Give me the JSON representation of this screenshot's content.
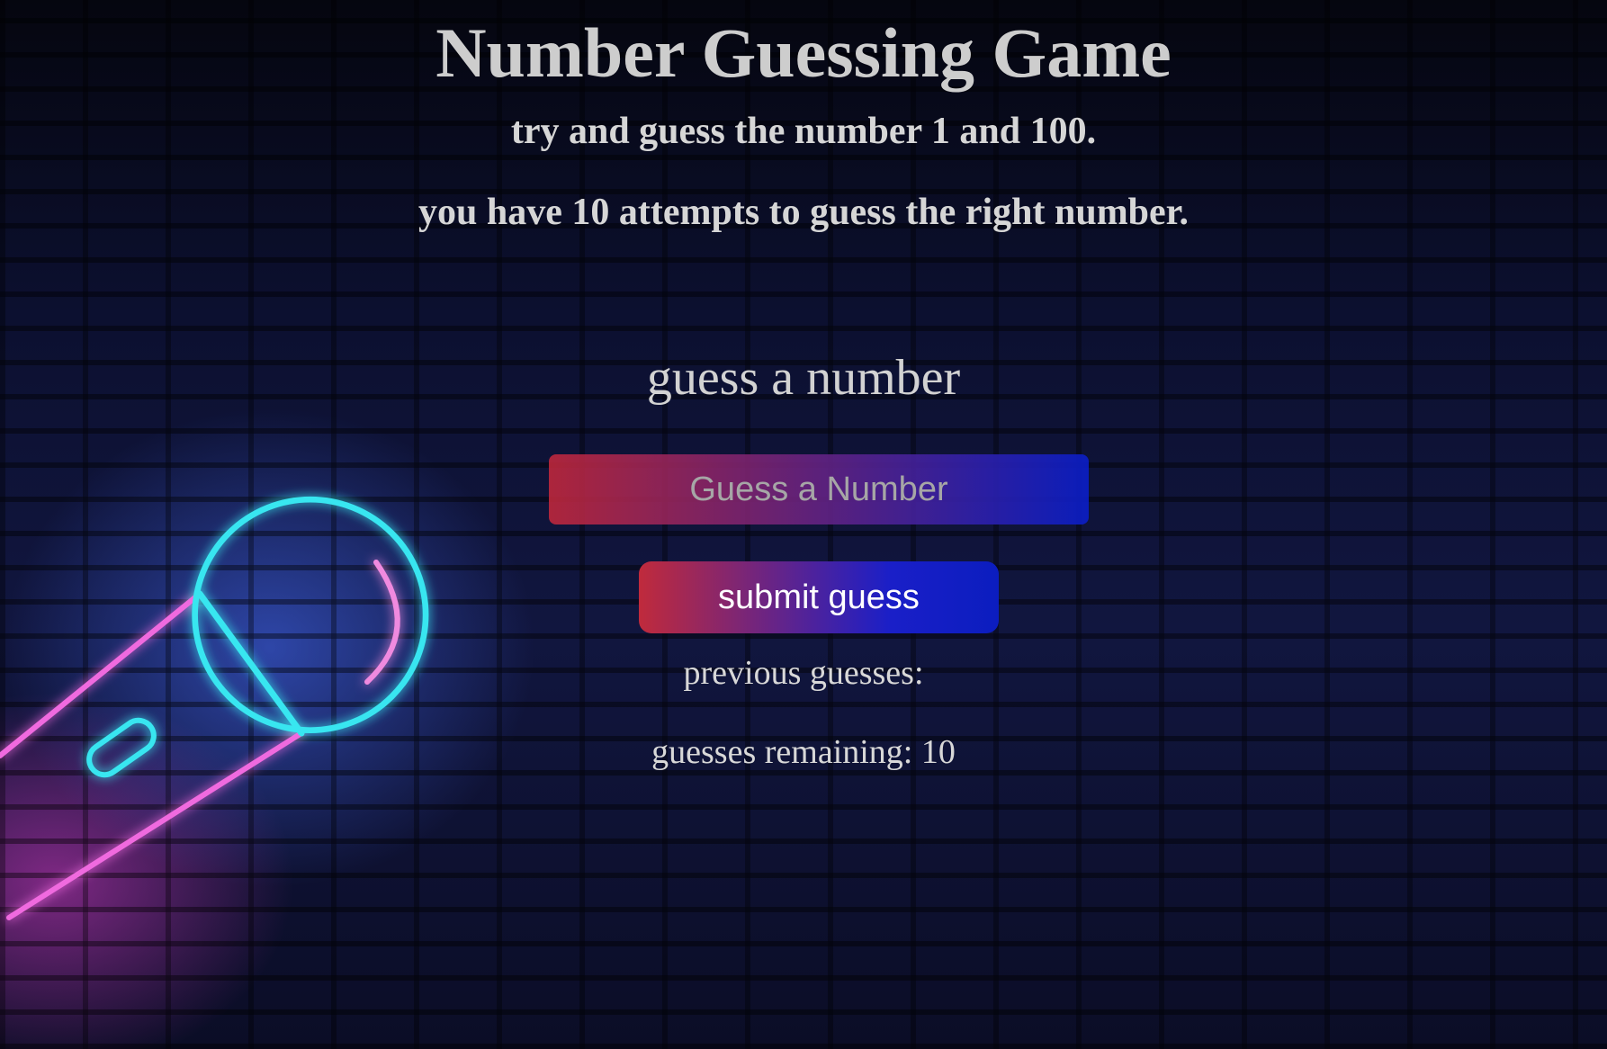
{
  "header": {
    "title": "Number Guessing Game",
    "subtitle_1": "try and guess the number 1 and 100.",
    "subtitle_2": "you have 10 attempts to guess the right number."
  },
  "form": {
    "label": "guess a number",
    "input_placeholder": "Guess a Number",
    "input_value": "",
    "submit_label": "submit guess"
  },
  "status": {
    "previous_guesses_label": "previous guesses:",
    "guesses_remaining_text": "guesses remaining: 10"
  },
  "colors": {
    "neon_cyan": "#39e6f0",
    "neon_pink": "#f06adf",
    "button_start": "#c02a3c",
    "button_end": "#0b1dbf"
  },
  "icons": [
    "microphone-neon-icon"
  ]
}
